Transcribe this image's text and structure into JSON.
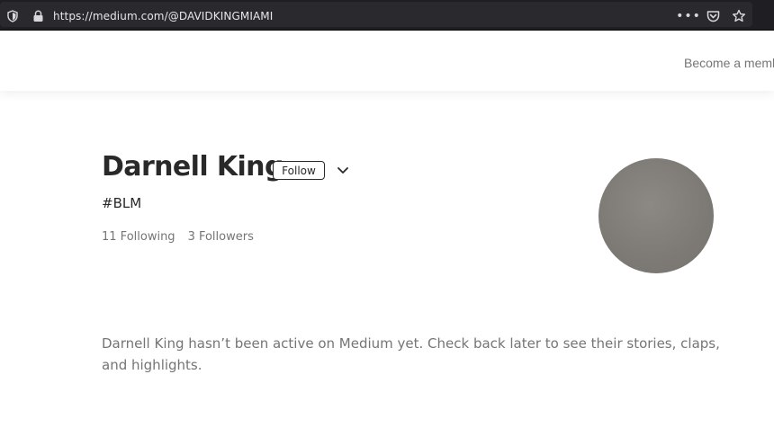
{
  "browser": {
    "url": "https://medium.com/@DAVIDKINGMIAMI",
    "icons": [
      "shield-icon",
      "lock-icon",
      "more-actions-icon",
      "pocket-icon",
      "bookmark-star-icon"
    ],
    "more_glyph": "•••"
  },
  "header": {
    "member_link": "Become a memb"
  },
  "profile": {
    "name": "Darnell King",
    "follow_label": "Follow",
    "bio": "#BLM",
    "following": "11 Following",
    "followers": "3 Followers",
    "avatar_color": "#7d7975"
  },
  "main": {
    "inactive_message": "Darnell King hasn’t been active on Medium yet. Check back later to see their stories, claps, and highlights."
  }
}
